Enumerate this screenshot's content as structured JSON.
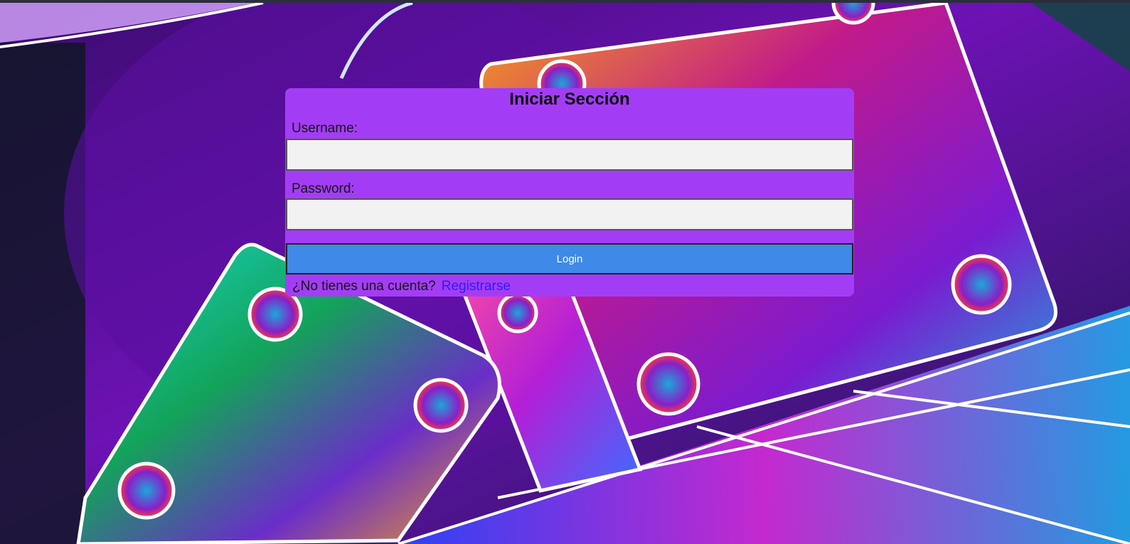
{
  "login": {
    "title": "Iniciar Sección",
    "username_label": "Username:",
    "username_value": "",
    "password_label": "Password:",
    "password_value": "",
    "login_button_label": "Login",
    "no_account_text": "¿No tienes una cuenta?",
    "register_link_label": "Registrarse"
  },
  "colors": {
    "card_background": "#a33df5",
    "input_background": "#f2f2f2",
    "button_background": "#3f8ae8",
    "link_color": "#2a1dff"
  },
  "background": {
    "description_icon": "neon-dice-wallpaper"
  }
}
